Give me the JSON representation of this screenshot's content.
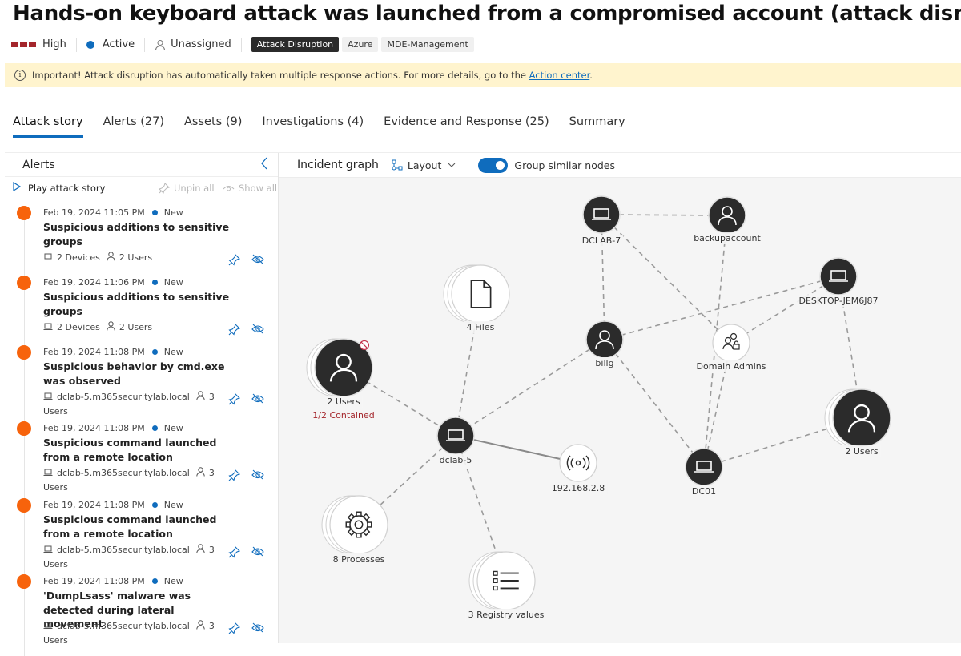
{
  "incident": {
    "title": "Hands-on keyboard attack was launched from a compromised account (attack disrup...",
    "severity": "High",
    "status": "Active",
    "assignee": "Unassigned",
    "tags": [
      {
        "label": "Attack Disruption",
        "style": "dark"
      },
      {
        "label": "Azure",
        "style": "light"
      },
      {
        "label": "MDE-Management",
        "style": "light"
      }
    ],
    "colors": {
      "severity": "#a4262c",
      "accent": "#0f6cbd",
      "alert_bullet": "#f7630c",
      "banner_bg": "#fff4ce"
    }
  },
  "banner": {
    "icon": "info-icon",
    "text": "Important! Attack disruption has automatically taken multiple response actions. For more details, go to the ",
    "link": "Action center",
    "suffix": "."
  },
  "tabs": [
    {
      "label": "Attack story",
      "active": true
    },
    {
      "label": "Alerts (27)",
      "active": false
    },
    {
      "label": "Assets (9)",
      "active": false
    },
    {
      "label": "Investigations (4)",
      "active": false
    },
    {
      "label": "Evidence and Response (25)",
      "active": false
    },
    {
      "label": "Summary",
      "active": false
    }
  ],
  "alerts_panel": {
    "title": "Alerts",
    "collapse_icon": "chevron-left-icon",
    "play_label": "Play attack story",
    "unpin_label": "Unpin all",
    "show_label": "Show all",
    "items": [
      {
        "date": "Feb 19, 2024 11:05 PM",
        "status": "New",
        "name": "Suspicious additions to sensitive groups",
        "device": "2 Devices",
        "users": "2 Users"
      },
      {
        "date": "Feb 19, 2024 11:06 PM",
        "status": "New",
        "name": "Suspicious additions to sensitive groups",
        "device": "2 Devices",
        "users": "2 Users"
      },
      {
        "date": "Feb 19, 2024 11:08 PM",
        "status": "New",
        "name": "Suspicious behavior by cmd.exe was observed",
        "device": "dclab-5.m365securitylab.local",
        "users": "3 Users"
      },
      {
        "date": "Feb 19, 2024 11:08 PM",
        "status": "New",
        "name": "Suspicious command launched from a remote location",
        "device": "dclab-5.m365securitylab.local",
        "users": "3 Users"
      },
      {
        "date": "Feb 19, 2024 11:08 PM",
        "status": "New",
        "name": "Suspicious command launched from a remote location",
        "device": "dclab-5.m365securitylab.local",
        "users": "3 Users"
      },
      {
        "date": "Feb 19, 2024 11:08 PM",
        "status": "New",
        "name": "'DumpLsass' malware was detected during lateral movement",
        "device": "dclab-5.m365securitylab.local",
        "users": "3 Users"
      }
    ]
  },
  "graph": {
    "title": "Incident graph",
    "layout_label": "Layout",
    "toggle_label": "Group similar nodes",
    "toggle_on": true,
    "nodes": [
      {
        "id": "dclab7",
        "label": "DCLAB-7",
        "type": "device",
        "theme": "dark"
      },
      {
        "id": "backup",
        "label": "backupaccount",
        "type": "user",
        "theme": "dark"
      },
      {
        "id": "desktop",
        "label": "DESKTOP-JEM6J87",
        "type": "device",
        "theme": "dark"
      },
      {
        "id": "files",
        "label": "4 Files",
        "type": "file",
        "theme": "light",
        "group": true
      },
      {
        "id": "billg",
        "label": "billg",
        "type": "user",
        "theme": "dark"
      },
      {
        "id": "domadm",
        "label": "Domain Admins",
        "type": "group",
        "theme": "light"
      },
      {
        "id": "users2a",
        "label": "2 Users",
        "sublabel": "1/2 Contained",
        "type": "user",
        "theme": "dark",
        "group": true,
        "contained": true
      },
      {
        "id": "dclab5",
        "label": "dclab-5",
        "type": "device",
        "theme": "dark"
      },
      {
        "id": "ip",
        "label": "192.168.2.8",
        "type": "ip",
        "theme": "light"
      },
      {
        "id": "dc01",
        "label": "DC01",
        "type": "device",
        "theme": "dark"
      },
      {
        "id": "users2b",
        "label": "2 Users",
        "type": "user",
        "theme": "dark",
        "group": true
      },
      {
        "id": "procs",
        "label": "8 Processes",
        "type": "process",
        "theme": "light",
        "group": true
      },
      {
        "id": "reg",
        "label": "3 Registry values",
        "type": "registry",
        "theme": "light",
        "group": true
      }
    ],
    "edges": [
      {
        "from": "dclab7",
        "to": "backup",
        "style": "dashed"
      },
      {
        "from": "dclab7",
        "to": "billg",
        "style": "dashed"
      },
      {
        "from": "dclab7",
        "to": "domadm",
        "style": "dashed"
      },
      {
        "from": "backup",
        "to": "dc01",
        "style": "dashed"
      },
      {
        "from": "desktop",
        "to": "billg",
        "style": "dashed"
      },
      {
        "from": "desktop",
        "to": "domadm",
        "style": "dashed"
      },
      {
        "from": "desktop",
        "to": "users2b",
        "style": "dashed"
      },
      {
        "from": "billg",
        "to": "dclab5",
        "style": "dashed"
      },
      {
        "from": "billg",
        "to": "dc01",
        "style": "dashed"
      },
      {
        "from": "domadm",
        "to": "dc01",
        "style": "dashed"
      },
      {
        "from": "files",
        "to": "dclab5",
        "style": "dashed"
      },
      {
        "from": "users2a",
        "to": "dclab5",
        "style": "dashed"
      },
      {
        "from": "dclab5",
        "to": "ip",
        "style": "solid"
      },
      {
        "from": "dclab5",
        "to": "procs",
        "style": "dashed"
      },
      {
        "from": "dclab5",
        "to": "reg",
        "style": "dashed"
      },
      {
        "from": "dc01",
        "to": "users2b",
        "style": "dashed"
      }
    ]
  }
}
